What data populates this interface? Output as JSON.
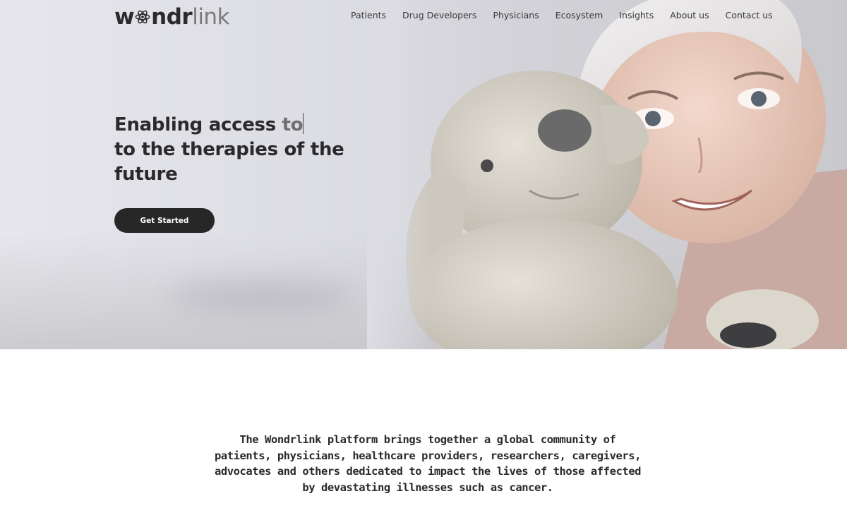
{
  "brand": {
    "logo_prefix": "w",
    "logo_middle": "ndr",
    "logo_suffix": "link",
    "logo_icon": "atom-icon"
  },
  "nav": {
    "items": [
      {
        "label": "Patients"
      },
      {
        "label": "Drug Developers"
      },
      {
        "label": "Physicians"
      },
      {
        "label": "Ecosystem"
      },
      {
        "label": "Insights"
      },
      {
        "label": "About us"
      },
      {
        "label": "Contact us"
      }
    ]
  },
  "hero": {
    "headline_start": "Enabling access ",
    "headline_typed": "to",
    "headline_rest": "to the therapies of the future",
    "cta_label": "Get Started",
    "image_description_icon": "child-with-teddy-bear-image"
  },
  "intro": {
    "text": "The Wondrlink platform brings together a global community of patients, physicians, healthcare providers, researchers, caregivers, advocates and others dedicated to impact the lives of those affected by devastating illnesses such as cancer."
  },
  "colors": {
    "button_bg": "#272727",
    "button_text": "#ffffff",
    "heading_text": "#2a2a2a",
    "logo_light": "#7b7b7b"
  }
}
